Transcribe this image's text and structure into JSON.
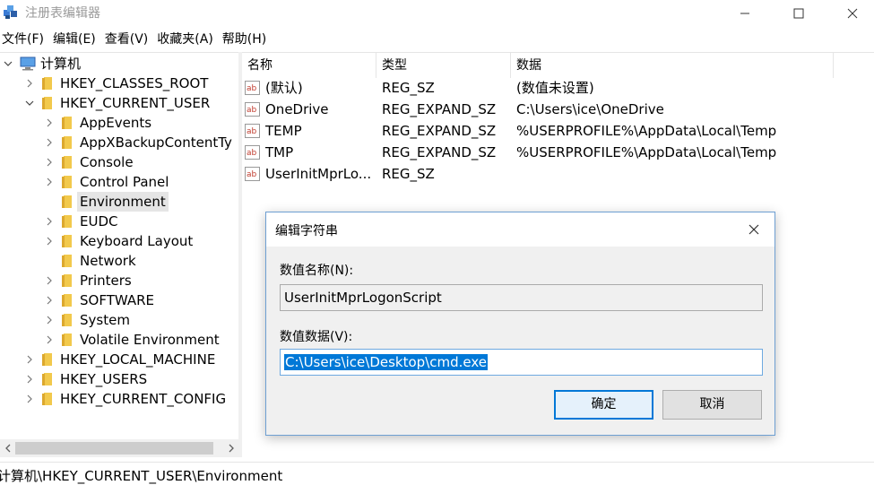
{
  "window": {
    "title": "注册表编辑器",
    "icon": "registry-editor-icon"
  },
  "menu": [
    "文件(F)",
    "编辑(E)",
    "查看(V)",
    "收藏夹(A)",
    "帮助(H)"
  ],
  "tree": {
    "root": "计算机",
    "hives": [
      {
        "label": "HKEY_CLASSES_ROOT",
        "expanded": false
      },
      {
        "label": "HKEY_CURRENT_USER",
        "expanded": true
      },
      {
        "label": "HKEY_LOCAL_MACHINE",
        "expanded": false
      },
      {
        "label": "HKEY_USERS",
        "expanded": false
      },
      {
        "label": "HKEY_CURRENT_CONFIG",
        "expanded": false
      }
    ],
    "current_user_children": [
      {
        "label": "AppEvents",
        "has_children": true,
        "selected": false
      },
      {
        "label": "AppXBackupContentTy",
        "has_children": true,
        "selected": false
      },
      {
        "label": "Console",
        "has_children": true,
        "selected": false
      },
      {
        "label": "Control Panel",
        "has_children": true,
        "selected": false
      },
      {
        "label": "Environment",
        "has_children": false,
        "selected": true
      },
      {
        "label": "EUDC",
        "has_children": true,
        "selected": false
      },
      {
        "label": "Keyboard Layout",
        "has_children": true,
        "selected": false
      },
      {
        "label": "Network",
        "has_children": false,
        "selected": false
      },
      {
        "label": "Printers",
        "has_children": true,
        "selected": false
      },
      {
        "label": "SOFTWARE",
        "has_children": true,
        "selected": false
      },
      {
        "label": "System",
        "has_children": true,
        "selected": false
      },
      {
        "label": "Volatile Environment",
        "has_children": true,
        "selected": false
      }
    ]
  },
  "list": {
    "columns": [
      "名称",
      "类型",
      "数据"
    ],
    "rows": [
      {
        "name": "(默认)",
        "type": "REG_SZ",
        "data": "(数值未设置)"
      },
      {
        "name": "OneDrive",
        "type": "REG_EXPAND_SZ",
        "data": "C:\\Users\\ice\\OneDrive"
      },
      {
        "name": "TEMP",
        "type": "REG_EXPAND_SZ",
        "data": "%USERPROFILE%\\AppData\\Local\\Temp"
      },
      {
        "name": "TMP",
        "type": "REG_EXPAND_SZ",
        "data": "%USERPROFILE%\\AppData\\Local\\Temp"
      },
      {
        "name": "UserInitMprLo...",
        "type": "REG_SZ",
        "data": ""
      }
    ]
  },
  "status": {
    "path": "计算机\\HKEY_CURRENT_USER\\Environment"
  },
  "dialog": {
    "title": "编辑字符串",
    "name_label": "数值名称(N):",
    "name_value": "UserInitMprLogonScript",
    "data_label": "数值数据(V):",
    "data_value": "C:\\Users\\ice\\Desktop\\cmd.exe",
    "ok_label": "确定",
    "cancel_label": "取消"
  },
  "colors": {
    "accent": "#0078d7",
    "folder": "#f2c94c",
    "selection_bg": "#e5e5e5",
    "dialog_bg": "#f0f0f0"
  }
}
